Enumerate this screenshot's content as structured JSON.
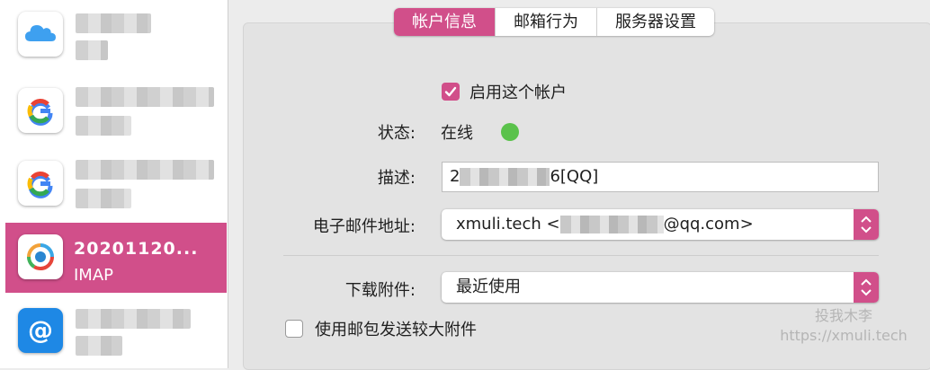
{
  "sidebar": {
    "accounts": [
      {
        "icon": "icloud-icon",
        "name": "",
        "type": ""
      },
      {
        "icon": "google-icon",
        "name": "",
        "type": ""
      },
      {
        "icon": "google-icon",
        "name": "",
        "type": ""
      },
      {
        "icon": "qq-mail-icon",
        "name": "20201120...",
        "type": "IMAP",
        "selected": true
      },
      {
        "icon": "at-sign-icon",
        "name": "",
        "type": ""
      }
    ]
  },
  "tabs": [
    "帐户信息",
    "邮箱行为",
    "服务器设置"
  ],
  "active_tab": "帐户信息",
  "form": {
    "enable_label": "启用这个帐户",
    "enable_checked": true,
    "status_label": "状态:",
    "status_value": "在线",
    "status_color": "#5ac24b",
    "description_label": "描述:",
    "description_prefix": "2",
    "description_suffix": "6[QQ]",
    "email_label": "电子邮件地址:",
    "email_prefix": "xmuli.tech <",
    "email_suffix": "@qq.com>",
    "download_label": "下载附件:",
    "download_value": "最近使用",
    "large_attach_label": "使用邮包发送较大附件",
    "large_attach_checked": false
  },
  "watermark": {
    "line1": "投我木李",
    "line2": "https://xmuli.tech"
  },
  "accent_color": "#d14f8a"
}
